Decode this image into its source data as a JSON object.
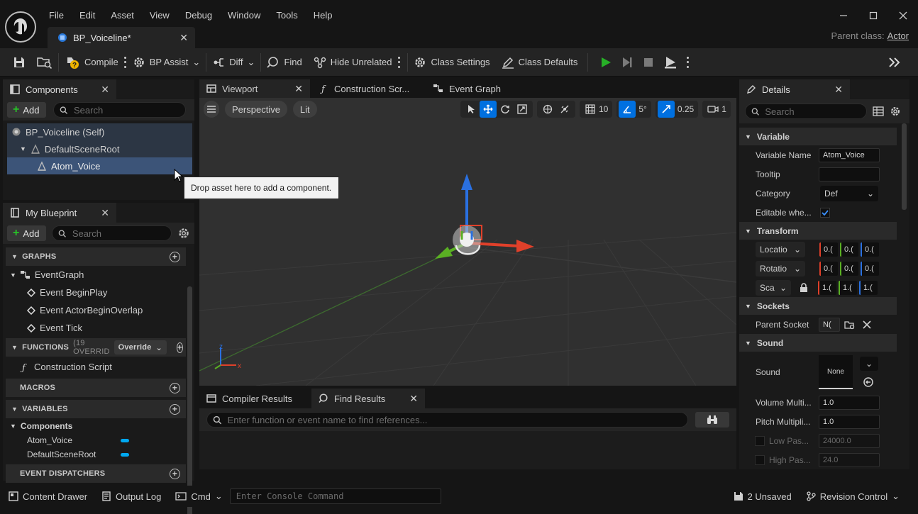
{
  "menu": [
    "File",
    "Edit",
    "Asset",
    "View",
    "Debug",
    "Window",
    "Tools",
    "Help"
  ],
  "doc_tab": {
    "label": "BP_Voiceline*"
  },
  "parent_class": {
    "label": "Parent class:",
    "value": "Actor"
  },
  "toolbar": {
    "compile": "Compile",
    "bp_assist": "BP Assist",
    "diff": "Diff",
    "find": "Find",
    "hide_unrelated": "Hide Unrelated",
    "class_settings": "Class Settings",
    "class_defaults": "Class Defaults"
  },
  "components": {
    "tab": "Components",
    "add": "Add",
    "search_placeholder": "Search",
    "tree": [
      "BP_Voiceline (Self)",
      "DefaultSceneRoot",
      "Atom_Voice"
    ]
  },
  "tooltip": "Drop asset here to add a component.",
  "my_blueprint": {
    "tab": "My Blueprint",
    "add": "Add",
    "search_placeholder": "Search",
    "graphs_header": "GRAPHS",
    "event_graph": "EventGraph",
    "events": [
      "Event BeginPlay",
      "Event ActorBeginOverlap",
      "Event Tick"
    ],
    "functions_header": "FUNCTIONS",
    "functions_count": "(19 OVERRID",
    "override": "Override",
    "construction_script": "Construction Script",
    "macros_header": "MACROS",
    "variables_header": "VARIABLES",
    "components_cat": "Components",
    "variables": [
      "Atom_Voice",
      "DefaultSceneRoot"
    ],
    "dispatchers_header": "EVENT DISPATCHERS"
  },
  "center_tabs": [
    "Viewport",
    "Construction Scr...",
    "Event Graph"
  ],
  "viewport": {
    "perspective": "Perspective",
    "lit": "Lit",
    "grid_snap": "10",
    "rot_snap": "5°",
    "scale_snap": "0.25",
    "cam_speed": "1"
  },
  "bottom_tabs": [
    "Compiler Results",
    "Find Results"
  ],
  "find_placeholder": "Enter function or event name to find references...",
  "details": {
    "tab": "Details",
    "search_placeholder": "Search",
    "variable_header": "Variable",
    "variable_name_label": "Variable Name",
    "variable_name_value": "Atom_Voice",
    "tooltip_label": "Tooltip",
    "category_label": "Category",
    "category_value": "Def",
    "editable_label": "Editable whe...",
    "transform_header": "Transform",
    "location_label": "Locatio",
    "rotation_label": "Rotatio",
    "scale_label": "Sca",
    "loc_values": [
      "0.(",
      "0.(",
      "0.("
    ],
    "rot_values": [
      "0.(",
      "0.(",
      "0.("
    ],
    "scale_values": [
      "1.(",
      "1.(",
      "1.("
    ],
    "sockets_header": "Sockets",
    "parent_socket_label": "Parent Socket",
    "parent_socket_value": "N(",
    "sound_header": "Sound",
    "sound_label": "Sound",
    "sound_value": "None",
    "volume_label": "Volume Multi...",
    "volume_value": "1.0",
    "pitch_label": "Pitch Multipli...",
    "pitch_value": "1.0",
    "lowpass_label": "Low Pas...",
    "lowpass_value": "24000.0",
    "highpass_label": "High Pas...",
    "highpass_value": "24.0"
  },
  "statusbar": {
    "content_drawer": "Content Drawer",
    "output_log": "Output Log",
    "cmd": "Cmd",
    "console_placeholder": "Enter Console Command",
    "unsaved": "2 Unsaved",
    "revision": "Revision Control"
  },
  "colors": {
    "accent": "#0070e0",
    "play": "#27b027",
    "variable_pill": "#00a8f0",
    "axis_x": "#e0402a",
    "axis_y": "#5ab023",
    "axis_z": "#2a70e0"
  }
}
